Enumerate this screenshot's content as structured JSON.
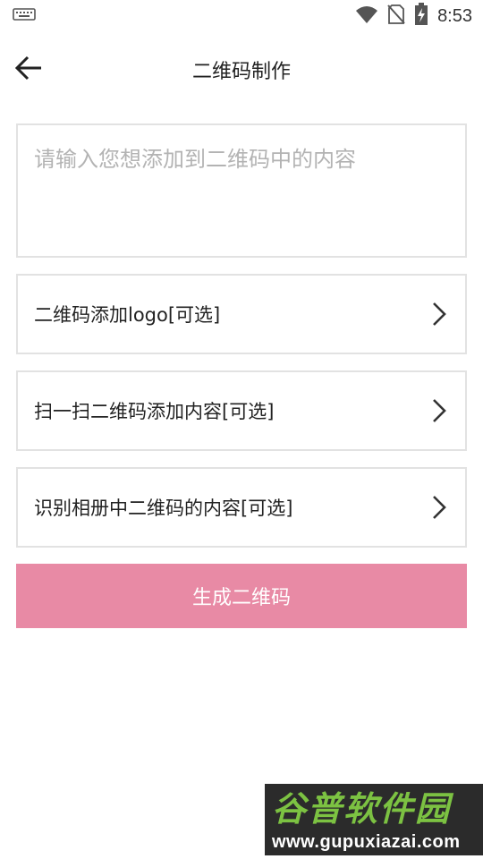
{
  "status_bar": {
    "time": "8:53",
    "icons": [
      "keyboard-icon",
      "wifi-icon",
      "no-sim-icon",
      "battery-charging-icon"
    ]
  },
  "header": {
    "title": "二维码制作",
    "back_icon": "arrow-left-icon"
  },
  "content_input": {
    "placeholder": "请输入您想添加到二维码中的内容",
    "value": ""
  },
  "options": [
    {
      "label": "二维码添加logo[可选]",
      "icon": "chevron-right-icon"
    },
    {
      "label": "扫一扫二维码添加内容[可选]",
      "icon": "chevron-right-icon"
    },
    {
      "label": "识别相册中二维码的内容[可选]",
      "icon": "chevron-right-icon"
    }
  ],
  "generate_button": {
    "label": "生成二维码"
  },
  "watermark": {
    "title": "谷普软件园",
    "url": "www.gupuxiazai.com"
  },
  "colors": {
    "accent_button": "#e88aa5",
    "border": "#e2e2e2",
    "placeholder": "#b3b3b3",
    "watermark_green": "#7cc242"
  }
}
